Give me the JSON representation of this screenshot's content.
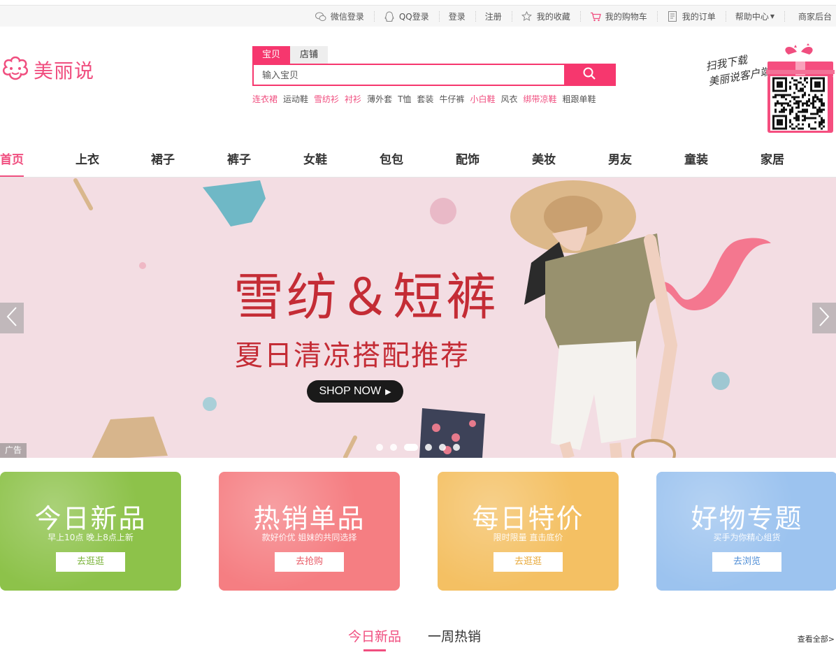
{
  "topbar": {
    "items": [
      {
        "label": "微信登录",
        "icon": "wechat-icon"
      },
      {
        "label": "QQ登录",
        "icon": "qq-icon"
      },
      {
        "label": "登录"
      },
      {
        "label": "注册"
      },
      {
        "label": "我的收藏",
        "icon": "star-icon"
      },
      {
        "label": "我的购物车",
        "icon": "cart-icon"
      },
      {
        "label": "我的订单",
        "icon": "order-icon"
      },
      {
        "label": "帮助中心",
        "icon": "caret-down-icon"
      },
      {
        "label": "商家后台"
      }
    ]
  },
  "logo": {
    "text": "美丽说"
  },
  "search": {
    "tabs": [
      "宝贝",
      "店铺"
    ],
    "placeholder": "输入宝贝",
    "hot_words": [
      {
        "label": "连衣裙",
        "highlight": true
      },
      {
        "label": "运动鞋",
        "highlight": false
      },
      {
        "label": "雪纺衫",
        "highlight": true
      },
      {
        "label": "衬衫",
        "highlight": true
      },
      {
        "label": "薄外套",
        "highlight": false
      },
      {
        "label": "T恤",
        "highlight": false
      },
      {
        "label": "套装",
        "highlight": false
      },
      {
        "label": "牛仔裤",
        "highlight": false
      },
      {
        "label": "小白鞋",
        "highlight": true
      },
      {
        "label": "风衣",
        "highlight": false
      },
      {
        "label": "绑带凉鞋",
        "highlight": true
      },
      {
        "label": "粗跟单鞋",
        "highlight": false
      }
    ]
  },
  "download": {
    "line1": "扫我下载",
    "line2": "美丽说客户端"
  },
  "categories": [
    "首页",
    "上衣",
    "裙子",
    "裤子",
    "女鞋",
    "包包",
    "配饰",
    "美妆",
    "男友",
    "童装",
    "家居"
  ],
  "banner": {
    "title": "雪纺＆短裤",
    "subtitle": "夏日清凉搭配推荐",
    "button": "SHOP NOW",
    "ad_label": "广告",
    "slide_count": 6,
    "active_slide": 3
  },
  "cards": [
    {
      "title": "今日新品",
      "subtitle": "早上10点 晚上8点上新",
      "button": "去逛逛",
      "color": "#8dc24a",
      "button_color": "#7ab33a"
    },
    {
      "title": "热销单品",
      "subtitle": "款好价优 姐妹的共同选择",
      "button": "去抢购",
      "color": "#f57e82",
      "button_color": "#e85a66"
    },
    {
      "title": "每日特价",
      "subtitle": "限时限量 直击底价",
      "button": "去逛逛",
      "color": "#f4c063",
      "button_color": "#e8a93a"
    },
    {
      "title": "好物专题",
      "subtitle": "买手为你精心组货",
      "button": "去浏览",
      "color": "#9cc3ef",
      "button_color": "#4f8ed6"
    }
  ],
  "bottom_tabs": [
    "今日新品",
    "一周热销"
  ],
  "view_all": "查看全部>",
  "accent": "#f04e7f"
}
